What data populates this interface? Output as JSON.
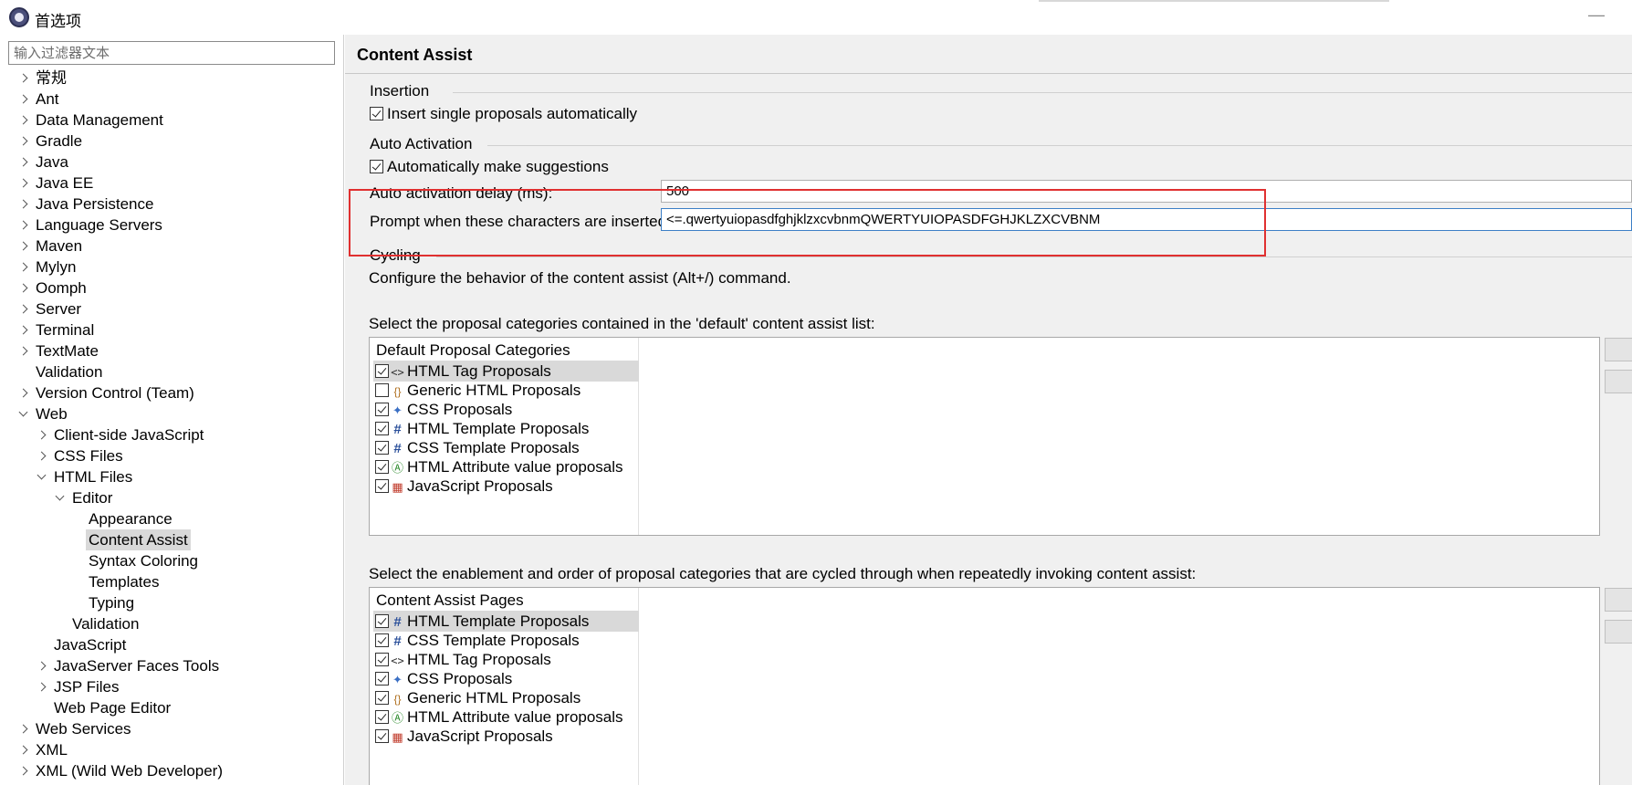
{
  "window": {
    "title": "首选项"
  },
  "filter": {
    "placeholder": "输入过滤器文本"
  },
  "tree": [
    {
      "label": "常规",
      "level": 0,
      "twisty": "closed"
    },
    {
      "label": "Ant",
      "level": 0,
      "twisty": "closed"
    },
    {
      "label": "Data Management",
      "level": 0,
      "twisty": "closed"
    },
    {
      "label": "Gradle",
      "level": 0,
      "twisty": "closed"
    },
    {
      "label": "Java",
      "level": 0,
      "twisty": "closed"
    },
    {
      "label": "Java EE",
      "level": 0,
      "twisty": "closed"
    },
    {
      "label": "Java Persistence",
      "level": 0,
      "twisty": "closed"
    },
    {
      "label": "Language Servers",
      "level": 0,
      "twisty": "closed"
    },
    {
      "label": "Maven",
      "level": 0,
      "twisty": "closed"
    },
    {
      "label": "Mylyn",
      "level": 0,
      "twisty": "closed"
    },
    {
      "label": "Oomph",
      "level": 0,
      "twisty": "closed"
    },
    {
      "label": "Server",
      "level": 0,
      "twisty": "closed"
    },
    {
      "label": "Terminal",
      "level": 0,
      "twisty": "closed"
    },
    {
      "label": "TextMate",
      "level": 0,
      "twisty": "closed"
    },
    {
      "label": "Validation",
      "level": 0,
      "twisty": "none"
    },
    {
      "label": "Version Control (Team)",
      "level": 0,
      "twisty": "closed"
    },
    {
      "label": "Web",
      "level": 0,
      "twisty": "open"
    },
    {
      "label": "Client-side JavaScript",
      "level": 1,
      "twisty": "closed"
    },
    {
      "label": "CSS Files",
      "level": 1,
      "twisty": "closed"
    },
    {
      "label": "HTML Files",
      "level": 1,
      "twisty": "open"
    },
    {
      "label": "Editor",
      "level": 2,
      "twisty": "open"
    },
    {
      "label": "Appearance",
      "level": 3,
      "twisty": "none"
    },
    {
      "label": "Content Assist",
      "level": 3,
      "twisty": "none",
      "selected": true
    },
    {
      "label": "Syntax Coloring",
      "level": 3,
      "twisty": "none"
    },
    {
      "label": "Templates",
      "level": 3,
      "twisty": "none"
    },
    {
      "label": "Typing",
      "level": 3,
      "twisty": "none"
    },
    {
      "label": "Validation",
      "level": 2,
      "twisty": "none"
    },
    {
      "label": "JavaScript",
      "level": 1,
      "twisty": "none"
    },
    {
      "label": "JavaServer Faces Tools",
      "level": 1,
      "twisty": "closed"
    },
    {
      "label": "JSP Files",
      "level": 1,
      "twisty": "closed"
    },
    {
      "label": "Web Page Editor",
      "level": 1,
      "twisty": "none"
    },
    {
      "label": "Web Services",
      "level": 0,
      "twisty": "closed"
    },
    {
      "label": "XML",
      "level": 0,
      "twisty": "closed"
    },
    {
      "label": "XML (Wild Web Developer)",
      "level": 0,
      "twisty": "closed"
    }
  ],
  "page": {
    "title": "Content Assist",
    "insertion": {
      "title": "Insertion",
      "insert_single": {
        "label": "Insert single proposals automatically",
        "checked": true
      }
    },
    "auto_activation": {
      "title": "Auto Activation",
      "make_suggestions": {
        "label": "Automatically make suggestions",
        "checked": true
      },
      "delay_label": "Auto activation delay (ms):",
      "delay_value": "500",
      "chars_label": "Prompt when these characters are inserted:",
      "chars_value": "<=.qwertyuiopasdfghjklzxcvbnmQWERTYUIOPASDFGHJKLZXCVBNM"
    },
    "cycling": {
      "title": "Cycling",
      "description": "Configure the behavior of the content assist (Alt+/) command."
    },
    "default_list": {
      "caption": "Select the proposal categories contained in the 'default' content assist list:",
      "header": "Default Proposal Categories",
      "items": [
        {
          "label": "HTML Tag Proposals",
          "checked": true,
          "icon": "tag-icon",
          "selected": true
        },
        {
          "label": "Generic HTML Proposals",
          "checked": false,
          "icon": "generic-html-icon"
        },
        {
          "label": "CSS Proposals",
          "checked": true,
          "icon": "css-icon"
        },
        {
          "label": "HTML Template Proposals",
          "checked": true,
          "icon": "template-icon"
        },
        {
          "label": "CSS Template Proposals",
          "checked": true,
          "icon": "template-icon"
        },
        {
          "label": "HTML Attribute value proposals",
          "checked": true,
          "icon": "attribute-icon"
        },
        {
          "label": "JavaScript Proposals",
          "checked": true,
          "icon": "javascript-icon"
        }
      ]
    },
    "cycle_list": {
      "caption": "Select the enablement and order of proposal categories that are cycled through when repeatedly invoking content assist:",
      "header": "Content Assist Pages",
      "items": [
        {
          "label": "HTML Template Proposals",
          "checked": true,
          "icon": "template-icon",
          "selected": true
        },
        {
          "label": "CSS Template Proposals",
          "checked": true,
          "icon": "template-icon"
        },
        {
          "label": "HTML Tag Proposals",
          "checked": true,
          "icon": "tag-icon"
        },
        {
          "label": "CSS Proposals",
          "checked": true,
          "icon": "css-icon"
        },
        {
          "label": "Generic HTML Proposals",
          "checked": true,
          "icon": "generic-html-icon"
        },
        {
          "label": "HTML Attribute value proposals",
          "checked": true,
          "icon": "attribute-icon"
        },
        {
          "label": "JavaScript Proposals",
          "checked": true,
          "icon": "javascript-icon"
        }
      ]
    }
  },
  "colors": {
    "highlight": "#e03030",
    "focus": "#3c7fc6",
    "selection": "#d9d9d9"
  }
}
